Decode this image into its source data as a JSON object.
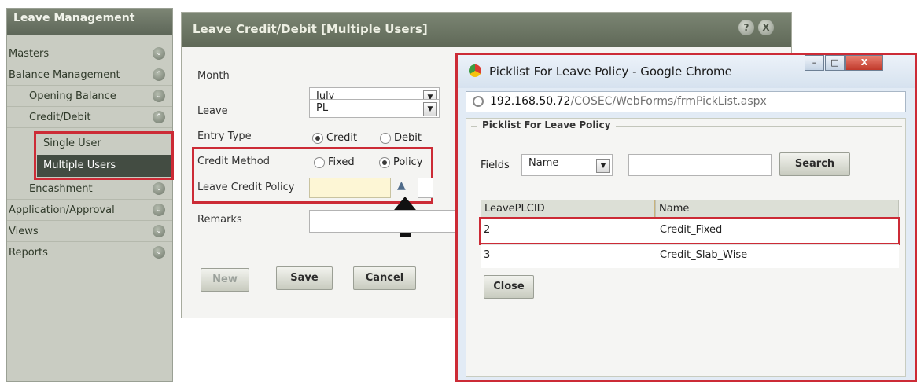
{
  "sidebar": {
    "title": "Leave Management",
    "items": [
      {
        "label": "Masters"
      },
      {
        "label": "Balance Management"
      },
      {
        "label": "Opening Balance"
      },
      {
        "label": "Credit/Debit"
      },
      {
        "label": "Single User"
      },
      {
        "label": "Multiple Users"
      },
      {
        "label": "Encashment"
      },
      {
        "label": "Application/Approval"
      },
      {
        "label": "Views"
      },
      {
        "label": "Reports"
      }
    ]
  },
  "panel": {
    "title": "Leave Credit/Debit [Multiple Users]",
    "help_icon": "?",
    "close_icon": "X",
    "fields": {
      "month_label": "Month",
      "month_value": "July",
      "leave_label": "Leave",
      "leave_value": "PL",
      "entry_type_label": "Entry Type",
      "entry_credit": "Credit",
      "entry_debit": "Debit",
      "credit_method_label": "Credit Method",
      "method_fixed": "Fixed",
      "method_policy": "Policy",
      "policy_label": "Leave Credit Policy",
      "remarks_label": "Remarks"
    },
    "buttons": {
      "new": "New",
      "save": "Save",
      "cancel": "Cancel"
    }
  },
  "popup": {
    "window_title": "Picklist For Leave Policy - Google Chrome",
    "url_host": "192.168.50.72",
    "url_path": "/COSEC/WebForms/frmPickList.aspx",
    "group_title": "Picklist For Leave Policy",
    "fields_label": "Fields",
    "fields_value": "Name",
    "search_button": "Search",
    "columns": [
      "LeavePLCID",
      "Name"
    ],
    "rows": [
      {
        "id": "2",
        "name": "Credit_Fixed"
      },
      {
        "id": "3",
        "name": "Credit_Slab_Wise"
      }
    ],
    "close_button": "Close",
    "colors": {
      "highlight": "#cc2b36",
      "header": "#5f6857"
    }
  }
}
